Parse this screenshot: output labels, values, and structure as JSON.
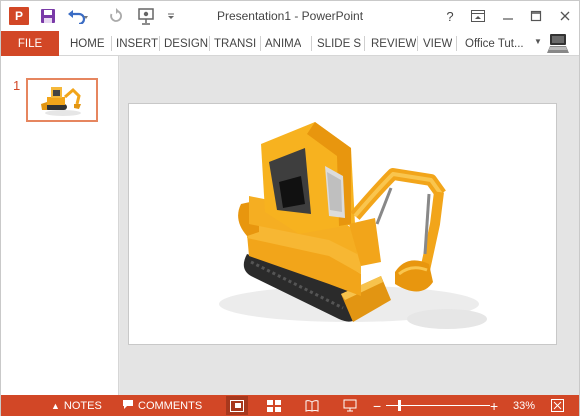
{
  "window": {
    "title": "Presentation1 - PowerPoint",
    "app_logo_letter": "P",
    "help_label": "?",
    "icons": {
      "app": "powerpoint-logo-icon",
      "save": "save-icon",
      "undo": "undo-icon",
      "redo": "redo-icon",
      "present": "start-from-beginning-icon",
      "customize": "customize-quick-access-icon",
      "help": "help-icon",
      "ribbon_display": "ribbon-display-options-icon",
      "minimize": "minimize-icon",
      "maximize": "maximize-icon",
      "close": "close-icon"
    }
  },
  "ribbon": {
    "file_tab": "FILE",
    "tabs": [
      "HOME",
      "INSERT",
      "DESIGN",
      "TRANSI",
      "ANIMA",
      "SLIDE S",
      "REVIEW",
      "VIEW"
    ],
    "account_name": "Office Tut..."
  },
  "thumbnails": [
    {
      "number": "1",
      "selected": true
    }
  ],
  "slide": {
    "content": "orange mini excavator 3D clipart"
  },
  "status_bar": {
    "notes_label": "NOTES",
    "comments_label": "COMMENTS",
    "zoom_percent": "33%",
    "zoom_level": 33,
    "active_view": "normal",
    "icons": {
      "notes": "notes-icon",
      "comments": "comments-icon",
      "normal_view": "normal-view-icon",
      "slide_sorter": "slide-sorter-icon",
      "reading_view": "reading-view-icon",
      "slide_show": "slide-show-icon",
      "zoom_out": "zoom-out-icon",
      "zoom_in": "zoom-in-icon",
      "fit": "fit-to-window-icon"
    }
  },
  "colors": {
    "accent": "#d24726",
    "active_view_bg": "#a7381d",
    "thumb_border": "#e6865f",
    "excavator_body": "#f2a51a"
  }
}
